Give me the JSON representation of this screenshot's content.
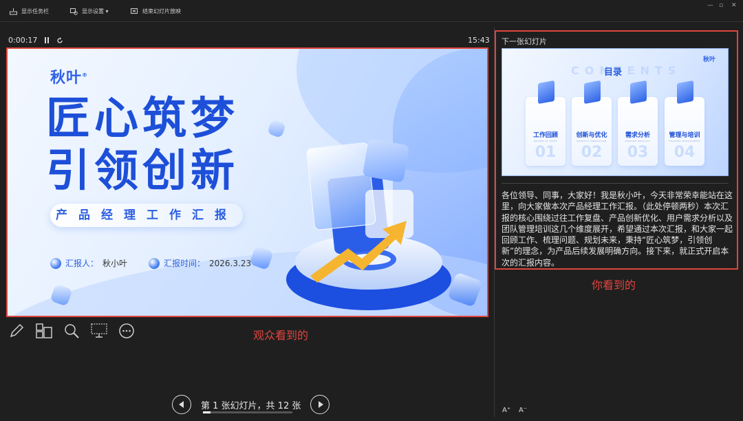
{
  "toolbar": {
    "show_taskbar": "显示任务栏",
    "display_settings": "显示设置 ▾",
    "end_show": "结束幻灯片放映"
  },
  "window_controls": {
    "minimize": "—",
    "restore": "▫",
    "close": "✕"
  },
  "timer": {
    "elapsed": "0:00:17",
    "pause_icon": "pause-icon",
    "reset_icon": "reset-icon"
  },
  "clock": "15:43",
  "slide": {
    "logo": "秋叶",
    "headline_line1": "匠心筑梦",
    "headline_line2": "引领创新",
    "subtitle": "产品经理工作汇报",
    "reporter_label": "汇报人：",
    "reporter_name": "秋小叶",
    "time_label": "汇报时间：",
    "time_value": "2026.3.23",
    "accent": "#1d4fd8"
  },
  "slide_tools": [
    "pen-icon",
    "slides-grid-icon",
    "zoom-icon",
    "screen-icon",
    "more-icon"
  ],
  "annotations": {
    "audience": "观众看到的",
    "presenter": "你看到的",
    "color": "#e0453f"
  },
  "nav": {
    "label": "第 1 张幻灯片，共 12 张",
    "progress": 0.083
  },
  "next": {
    "label": "下一张幻灯片",
    "thumb_logo": "秋叶",
    "thumb_ghost": "CONTENTS",
    "thumb_title": "目录",
    "items": [
      {
        "label": "工作回顾",
        "sub": "REVIEW OF WORK",
        "num": "01"
      },
      {
        "label": "创新与优化",
        "sub": "PRODUCT INNOVATION",
        "num": "02"
      },
      {
        "label": "需求分析",
        "sub": "DEMAND ANALYSIS",
        "num": "03"
      },
      {
        "label": "管理与培训",
        "sub": "TRAINING MANAGEMENT",
        "num": "04"
      }
    ]
  },
  "notes": "各位领导、同事，大家好！我是秋小叶，今天非常荣幸能站在这里，向大家做本次产品经理工作汇报。（此处停顿两秒）本次汇报的核心围绕过往工作复盘、产品创新优化、用户需求分析以及团队管理培训这几个维度展开，希望通过本次汇报，和大家一起回顾工作、梳理问题、规划未来，秉持“匠心筑梦，引领创新”的理念，为产品后续发展明确方向。接下来，就正式开启本次的汇报内容。",
  "font_controls": {
    "increase": "A⁺",
    "decrease": "A⁻"
  }
}
